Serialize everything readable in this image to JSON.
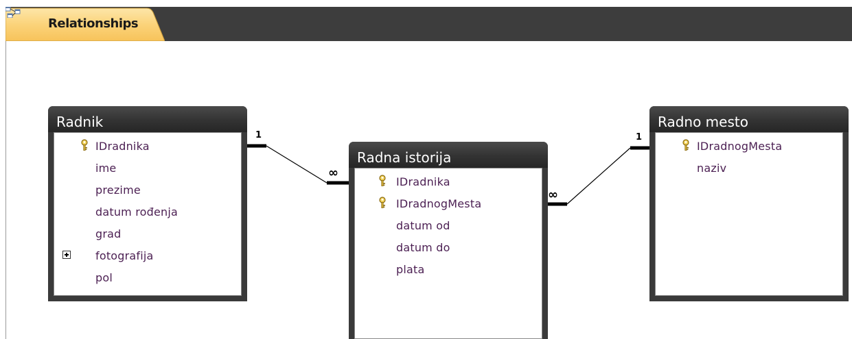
{
  "tab": {
    "label": "Relationships",
    "icon": "relationships-icon"
  },
  "tables": {
    "radnik": {
      "title": "Radnik",
      "fields": [
        {
          "name": "IDradnika",
          "key": true
        },
        {
          "name": "ime"
        },
        {
          "name": "prezime"
        },
        {
          "name": "datum rođenja"
        },
        {
          "name": "grad"
        },
        {
          "name": "fotografija",
          "expand": true
        },
        {
          "name": "pol"
        }
      ]
    },
    "radna_istorija": {
      "title": "Radna istorija",
      "fields": [
        {
          "name": "IDradnika",
          "key": true
        },
        {
          "name": "IDradnogMesta",
          "key": true
        },
        {
          "name": "datum od"
        },
        {
          "name": "datum do"
        },
        {
          "name": "plata"
        }
      ]
    },
    "radno_mesto": {
      "title": "Radno mesto",
      "fields": [
        {
          "name": "IDradnogMesta",
          "key": true
        },
        {
          "name": "naziv"
        }
      ]
    }
  },
  "relationships": [
    {
      "from": "Radnik.IDradnika",
      "to": "Radna istorija.IDradnika",
      "one": "1",
      "many": "∞"
    },
    {
      "from": "Radno mesto.IDradnogMesta",
      "to": "Radna istorija.IDradnogMesta",
      "one": "1",
      "many": "∞"
    }
  ],
  "colors": {
    "tab_active": "#fbd37a",
    "tab_bar": "#3d3d3d",
    "table_header": "#333333",
    "field_text": "#4b1f52"
  }
}
